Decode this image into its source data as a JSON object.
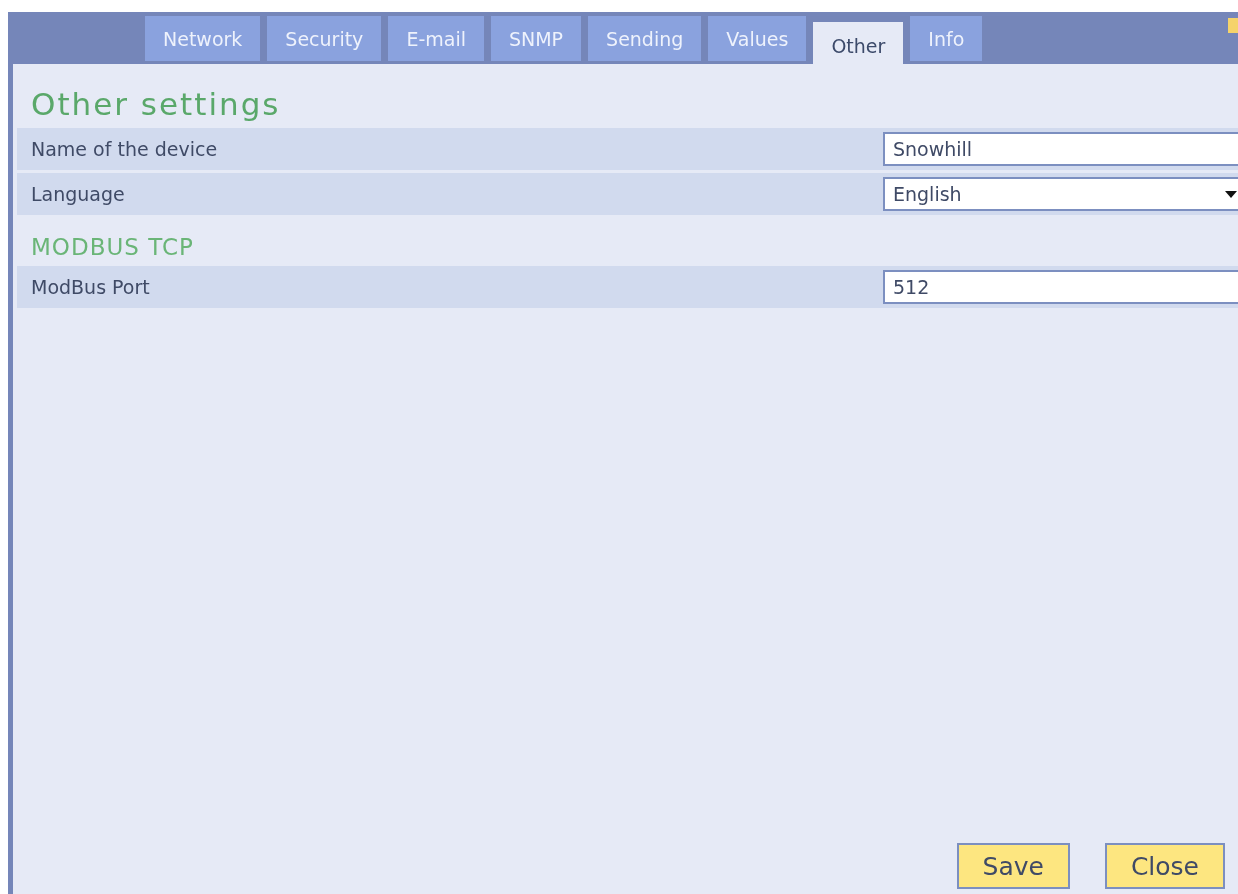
{
  "tabs": [
    {
      "label": "Network",
      "selected": false
    },
    {
      "label": "Security",
      "selected": false
    },
    {
      "label": "E-mail",
      "selected": false
    },
    {
      "label": "SNMP",
      "selected": false
    },
    {
      "label": "Sending",
      "selected": false
    },
    {
      "label": "Values",
      "selected": false
    },
    {
      "label": "Other",
      "selected": true
    },
    {
      "label": "Info",
      "selected": false
    }
  ],
  "title": "Other settings",
  "sections": [
    {
      "rows": [
        {
          "label": "Name of the device",
          "kind": "text",
          "value": "Snowhill"
        },
        {
          "label": "Language",
          "kind": "select",
          "value": "English"
        }
      ]
    },
    {
      "heading": "MODBUS TCP",
      "rows": [
        {
          "label": "ModBus Port",
          "kind": "text",
          "value": "512"
        }
      ]
    }
  ],
  "buttons": [
    "Save",
    "Close"
  ]
}
